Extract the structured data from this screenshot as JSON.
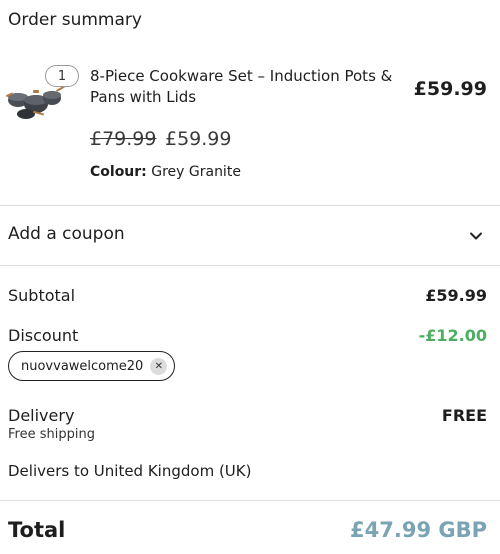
{
  "summary": {
    "title": "Order summary"
  },
  "item": {
    "quantity": "1",
    "name": "8-Piece Cookware Set – Induction Pots & Pans with Lids",
    "line_total": "£59.99",
    "original_price": "£79.99",
    "sale_price": "£59.99",
    "colour_label": "Colour:",
    "colour_value": "Grey Granite",
    "image_icon": "cookware-set-thumbnail"
  },
  "coupon": {
    "label": "Add a coupon",
    "icon": "chevron-down-icon"
  },
  "totals": {
    "subtotal_label": "Subtotal",
    "subtotal_value": "£59.99",
    "discount_label": "Discount",
    "discount_value": "-£12.00",
    "coupon_code": "nuovvawelcome20",
    "delivery_label": "Delivery",
    "delivery_value": "FREE",
    "delivery_note": "Free shipping",
    "delivers_to": "Delivers to United Kingdom (UK)",
    "total_label": "Total",
    "total_value": "£47.99 GBP"
  },
  "colors": {
    "discount": "#4cae63",
    "total": "#7aa3b3",
    "divider": "#dedede"
  }
}
